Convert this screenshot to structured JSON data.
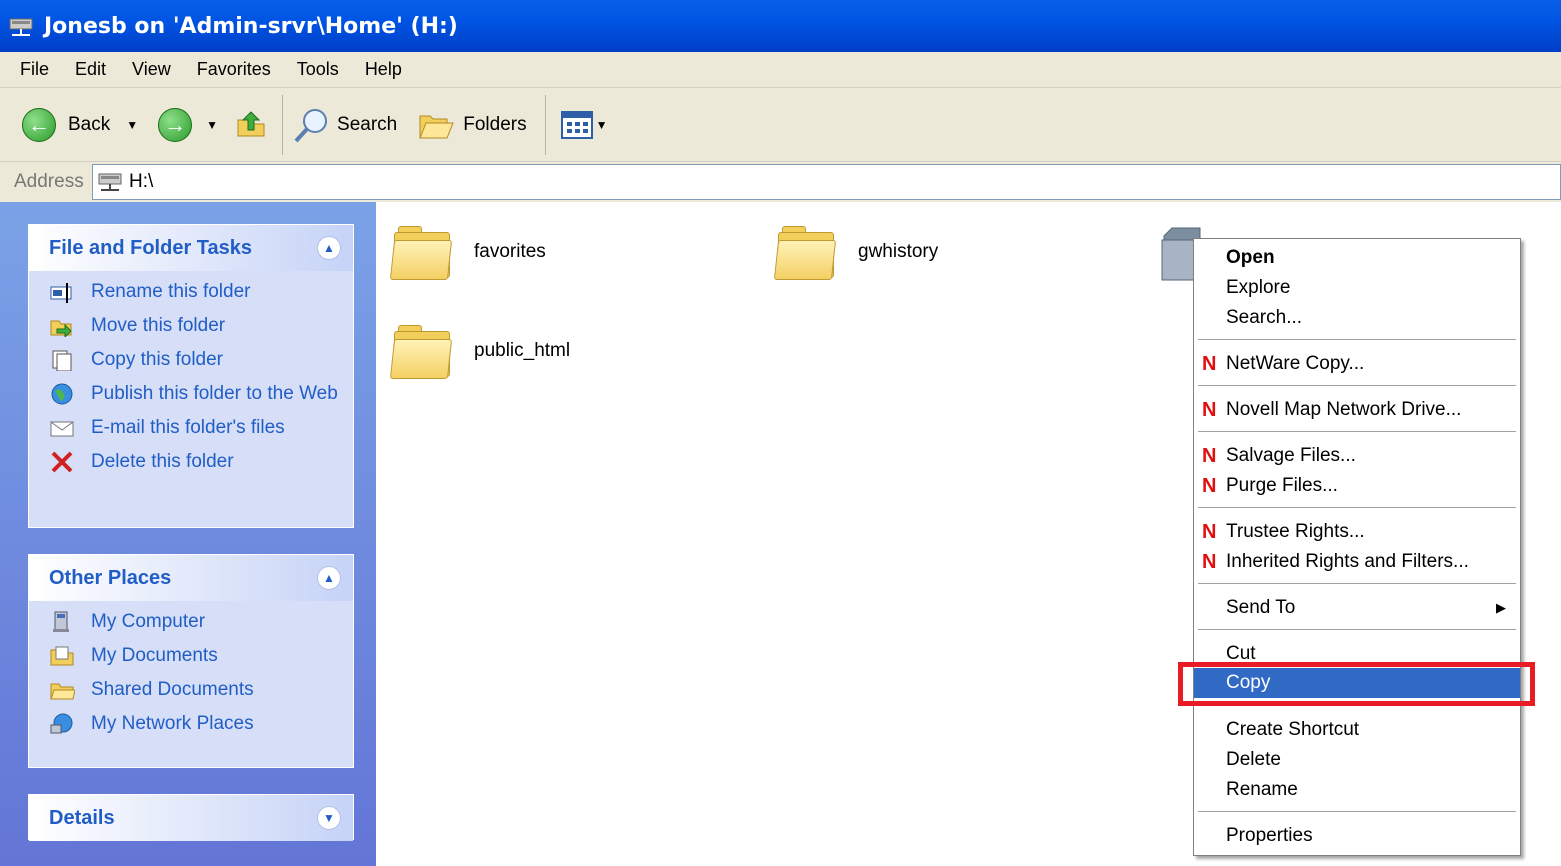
{
  "window": {
    "title": "Jonesb on 'Admin-srvr\\Home' (H:)"
  },
  "menu": [
    "File",
    "Edit",
    "View",
    "Favorites",
    "Tools",
    "Help"
  ],
  "toolbar": {
    "back": "Back",
    "search": "Search",
    "folders": "Folders"
  },
  "address": {
    "label": "Address",
    "value": "H:\\"
  },
  "tasks": {
    "title": "File and Folder Tasks",
    "items": [
      "Rename this folder",
      "Move this folder",
      "Copy this folder",
      "Publish this folder to the Web",
      "E-mail this folder's files",
      "Delete this folder"
    ]
  },
  "other": {
    "title": "Other Places",
    "items": [
      "My Computer",
      "My Documents",
      "Shared Documents",
      "My Network Places"
    ]
  },
  "details": {
    "title": "Details"
  },
  "folders": [
    "favorites",
    "gwhistory",
    "public_html"
  ],
  "context_menu": {
    "items": [
      "Open",
      "Explore",
      "Search...",
      "NetWare Copy...",
      "Novell Map Network Drive...",
      "Salvage Files...",
      "Purge Files...",
      "Trustee Rights...",
      "Inherited Rights and Filters...",
      "Send To",
      "Cut",
      "Copy",
      "Create Shortcut",
      "Delete",
      "Rename",
      "Properties"
    ],
    "selected": "Copy",
    "novell_marker": "N"
  },
  "colors": {
    "title_bar": "#0054e3",
    "selection": "#316ac5",
    "highlight_box": "#e81c24",
    "novell": "#e01010"
  }
}
